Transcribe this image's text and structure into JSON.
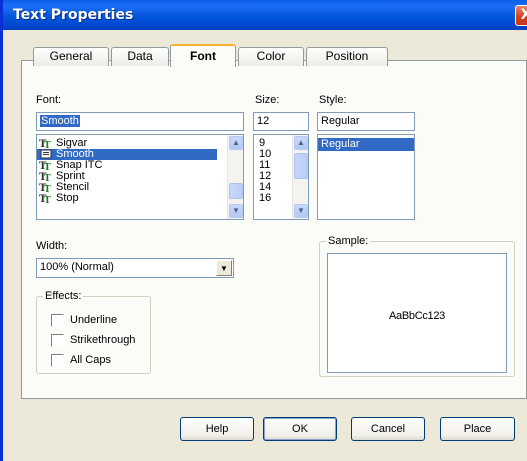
{
  "window": {
    "title": "Text Properties",
    "close_glyph": "X"
  },
  "tabs": [
    {
      "label": "General"
    },
    {
      "label": "Data"
    },
    {
      "label": "Font",
      "active": true
    },
    {
      "label": "Color"
    },
    {
      "label": "Position"
    }
  ],
  "font": {
    "label": "Font:",
    "value": "Smooth",
    "list": [
      "Sigvar",
      "Smooth",
      "Snap ITC",
      "Sprint",
      "Stencil",
      "Stop"
    ],
    "selected": "Smooth"
  },
  "size": {
    "label": "Size:",
    "value": "12",
    "list": [
      "9",
      "10",
      "11",
      "12",
      "14",
      "16"
    ]
  },
  "style": {
    "label": "Style:",
    "value": "Regular",
    "list": [
      "Regular"
    ],
    "selected": "Regular"
  },
  "width": {
    "label": "Width:",
    "value": "100% (Normal)"
  },
  "effects": {
    "label": "Effects:",
    "items": [
      {
        "label": "Underline",
        "checked": false
      },
      {
        "label": "Strikethrough",
        "checked": false
      },
      {
        "label": "All Caps",
        "checked": false
      }
    ]
  },
  "sample": {
    "label": "Sample:",
    "text": "AaBbCc123"
  },
  "buttons": {
    "help": "Help",
    "ok": "OK",
    "cancel": "Cancel",
    "place": "Place"
  },
  "icons": {
    "font_item": "truetype-font-icon",
    "selected_font_item": "printer-font-icon",
    "scroll_up": "scroll-up-arrow-icon",
    "scroll_down": "scroll-down-arrow-icon",
    "dropdown": "dropdown-arrow-icon"
  },
  "colors": {
    "titlebar": "#0256dc",
    "selection": "#316ac5",
    "active_tab_accent": "#f8b334",
    "close_button": "#d8431f"
  }
}
